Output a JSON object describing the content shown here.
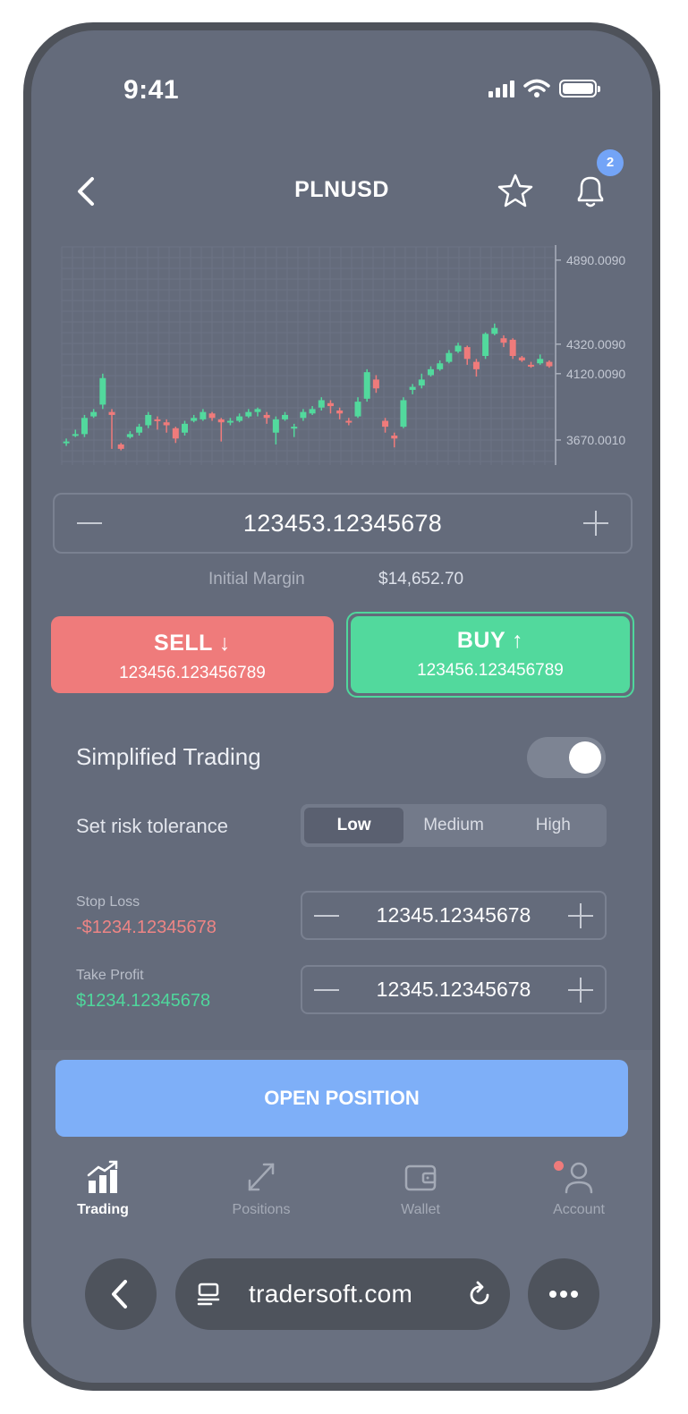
{
  "status": {
    "time": "9:41"
  },
  "header": {
    "title": "PLNUSD",
    "notification_count": "2"
  },
  "chart_data": {
    "type": "candlestick",
    "y_tick_labels": [
      "4890.0090",
      "4320.0090",
      "4120.0090",
      "3670.0010"
    ],
    "ylim": [
      3500,
      4980
    ],
    "candles": [
      [
        3650,
        3680,
        3660,
        3630
      ],
      [
        3700,
        3740,
        3710,
        3690
      ],
      [
        3710,
        3840,
        3820,
        3690
      ],
      [
        3830,
        3880,
        3860,
        3820
      ],
      [
        3910,
        4120,
        4090,
        3880
      ],
      [
        3860,
        3880,
        3840,
        3610
      ],
      [
        3640,
        3650,
        3610,
        3600
      ],
      [
        3690,
        3730,
        3710,
        3680
      ],
      [
        3720,
        3780,
        3760,
        3700
      ],
      [
        3770,
        3860,
        3840,
        3750
      ],
      [
        3810,
        3830,
        3800,
        3740
      ],
      [
        3790,
        3810,
        3770,
        3720
      ],
      [
        3750,
        3760,
        3680,
        3650
      ],
      [
        3720,
        3800,
        3780,
        3700
      ],
      [
        3800,
        3840,
        3820,
        3790
      ],
      [
        3810,
        3880,
        3860,
        3800
      ],
      [
        3850,
        3860,
        3820,
        3800
      ],
      [
        3810,
        3820,
        3790,
        3660
      ],
      [
        3790,
        3820,
        3800,
        3770
      ],
      [
        3800,
        3850,
        3830,
        3790
      ],
      [
        3830,
        3880,
        3860,
        3820
      ],
      [
        3860,
        3890,
        3880,
        3830
      ],
      [
        3840,
        3860,
        3820,
        3780
      ],
      [
        3720,
        3830,
        3810,
        3640
      ],
      [
        3810,
        3860,
        3840,
        3800
      ],
      [
        3750,
        3780,
        3760,
        3690
      ],
      [
        3820,
        3880,
        3860,
        3800
      ],
      [
        3850,
        3900,
        3880,
        3840
      ],
      [
        3890,
        3960,
        3940,
        3870
      ],
      [
        3920,
        3940,
        3900,
        3850
      ],
      [
        3870,
        3890,
        3850,
        3810
      ],
      [
        3800,
        3820,
        3790,
        3770
      ],
      [
        3830,
        3960,
        3930,
        3820
      ],
      [
        3950,
        4150,
        4130,
        3930
      ],
      [
        4080,
        4110,
        4020,
        3990
      ],
      [
        3800,
        3820,
        3760,
        3720
      ],
      [
        3700,
        3720,
        3680,
        3620
      ],
      [
        3760,
        3960,
        3940,
        3750
      ],
      [
        4010,
        4050,
        4030,
        3980
      ],
      [
        4040,
        4120,
        4080,
        4020
      ],
      [
        4110,
        4170,
        4150,
        4100
      ],
      [
        4150,
        4210,
        4190,
        4140
      ],
      [
        4200,
        4280,
        4260,
        4190
      ],
      [
        4270,
        4330,
        4310,
        4260
      ],
      [
        4300,
        4310,
        4220,
        4180
      ],
      [
        4200,
        4220,
        4150,
        4100
      ],
      [
        4240,
        4400,
        4390,
        4220
      ],
      [
        4390,
        4460,
        4430,
        4380
      ],
      [
        4360,
        4380,
        4330,
        4300
      ],
      [
        4350,
        4360,
        4240,
        4220
      ],
      [
        4230,
        4240,
        4210,
        4200
      ],
      [
        4180,
        4200,
        4170,
        4160
      ],
      [
        4190,
        4250,
        4220,
        4180
      ],
      [
        4200,
        4210,
        4170,
        4160
      ]
    ]
  },
  "amount": {
    "value": "123453.12345678"
  },
  "margin": {
    "label": "Initial Margin",
    "value": "$14,652.70"
  },
  "sell": {
    "label": "SELL ↓",
    "price": "123456.123456789"
  },
  "buy": {
    "label": "BUY ↑",
    "price": "123456.123456789"
  },
  "simplified": {
    "label": "Simplified Trading",
    "enabled": true
  },
  "risk": {
    "label": "Set risk tolerance",
    "options": [
      "Low",
      "Medium",
      "High"
    ],
    "selected": "Low"
  },
  "stop_loss": {
    "label": "Stop Loss",
    "amount": "-$1234.12345678",
    "value": "12345.12345678"
  },
  "take_profit": {
    "label": "Take Profit",
    "amount": "$1234.12345678",
    "value": "12345.12345678"
  },
  "open_position": {
    "label": "OPEN POSITION"
  },
  "tabs": [
    {
      "label": "Trading",
      "icon": "chart-growth-icon",
      "active": true
    },
    {
      "label": "Positions",
      "icon": "arrows-exchange-icon",
      "active": false
    },
    {
      "label": "Wallet",
      "icon": "wallet-icon",
      "active": false
    },
    {
      "label": "Account",
      "icon": "user-icon",
      "active": false
    }
  ],
  "browser": {
    "url": "tradersoft.com"
  },
  "colors": {
    "up": "#52d99d",
    "down": "#ef7b7b",
    "accent": "#7eaff8"
  }
}
